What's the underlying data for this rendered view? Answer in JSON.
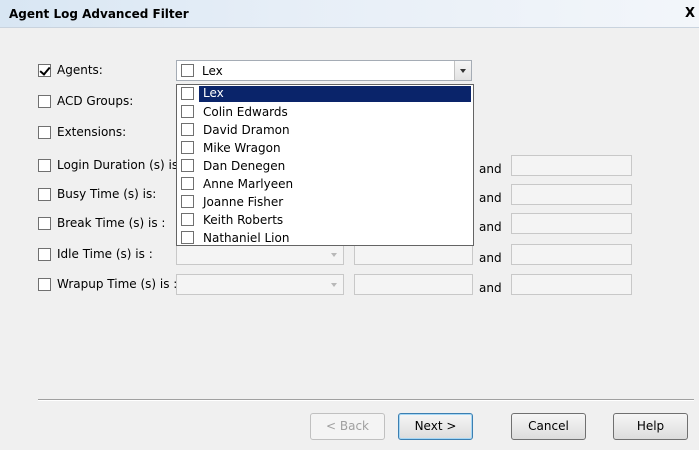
{
  "window": {
    "title": "Agent Log Advanced Filter",
    "close_glyph": "X"
  },
  "filters": [
    {
      "label": "Agents:",
      "checked": true,
      "control": "combo",
      "value": "Lex"
    },
    {
      "label": "ACD Groups:",
      "checked": false
    },
    {
      "label": "Extensions:",
      "checked": false
    },
    {
      "label": "Login Duration (s) is:",
      "checked": false,
      "and_label": "and"
    },
    {
      "label": "Busy Time (s) is:",
      "checked": false,
      "and_label": "and"
    },
    {
      "label": "Break Time (s) is :",
      "checked": false,
      "and_label": "and"
    },
    {
      "label": "Idle Time (s) is :",
      "checked": false,
      "and_label": "and"
    },
    {
      "label": "Wrapup Time (s) is :",
      "checked": false,
      "and_label": "and"
    }
  ],
  "agents_dropdown": {
    "options": [
      {
        "label": "Lex",
        "selected": true
      },
      {
        "label": "Colin Edwards"
      },
      {
        "label": "David Dramon"
      },
      {
        "label": "Mike Wragon"
      },
      {
        "label": "Dan Denegen"
      },
      {
        "label": "Anne Marlyeen"
      },
      {
        "label": "Joanne Fisher"
      },
      {
        "label": "Keith Roberts"
      },
      {
        "label": "Nathaniel Lion"
      }
    ]
  },
  "buttons": {
    "back": "< Back",
    "next": "Next >",
    "cancel": "Cancel",
    "help": "Help"
  }
}
